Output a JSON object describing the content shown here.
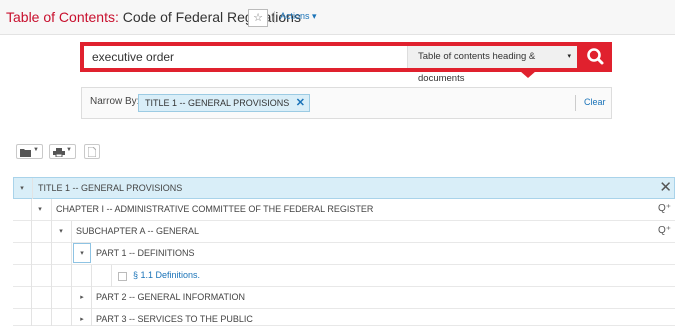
{
  "header": {
    "title_label": "Table of Contents:",
    "title_name": "Code of Federal Regulations",
    "actions_label": "Actions ▾"
  },
  "search": {
    "query": "executive order",
    "scope": "Table of contents heading & documents",
    "scope_caret": "▾"
  },
  "narrow": {
    "label": "Narrow By:",
    "chip_text": "TITLE 1 -- GENERAL PROVISIONS",
    "chip_remove": "✕",
    "clear_label": "Clear"
  },
  "toolbar": {
    "items": [
      {
        "icon": "folder-icon",
        "has_dropdown": true
      },
      {
        "icon": "print-icon",
        "has_dropdown": true
      },
      {
        "icon": "document-icon",
        "has_dropdown": false
      }
    ]
  },
  "tree": {
    "rows": [
      {
        "label": "TITLE 1 -- GENERAL PROVISIONS",
        "toggle": "▾",
        "depth": 0,
        "right_icon": "close-icon"
      },
      {
        "label": "CHAPTER I -- ADMINISTRATIVE COMMITTEE OF THE FEDERAL REGISTER",
        "toggle": "▾",
        "depth": 1,
        "right_icon": "search-in-icon"
      },
      {
        "label": "SUBCHAPTER A -- GENERAL",
        "toggle": "▾",
        "depth": 2,
        "right_icon": "search-in-icon"
      },
      {
        "label": "PART 1 -- DEFINITIONS",
        "toggle": "▾",
        "depth": 3,
        "right_icon": ""
      },
      {
        "label": "§ 1.1 Definitions.",
        "toggle": "",
        "depth": 4,
        "right_icon": ""
      },
      {
        "label": "PART 2 -- GENERAL INFORMATION",
        "toggle": "▸",
        "depth": 3,
        "right_icon": ""
      },
      {
        "label": "PART 3 -- SERVICES TO THE PUBLIC",
        "toggle": "▸",
        "depth": 3,
        "right_icon": ""
      }
    ]
  },
  "colors": {
    "accent_red": "#e0212e",
    "link_blue": "#1a73b8",
    "selected_bg": "#d9eef8"
  }
}
